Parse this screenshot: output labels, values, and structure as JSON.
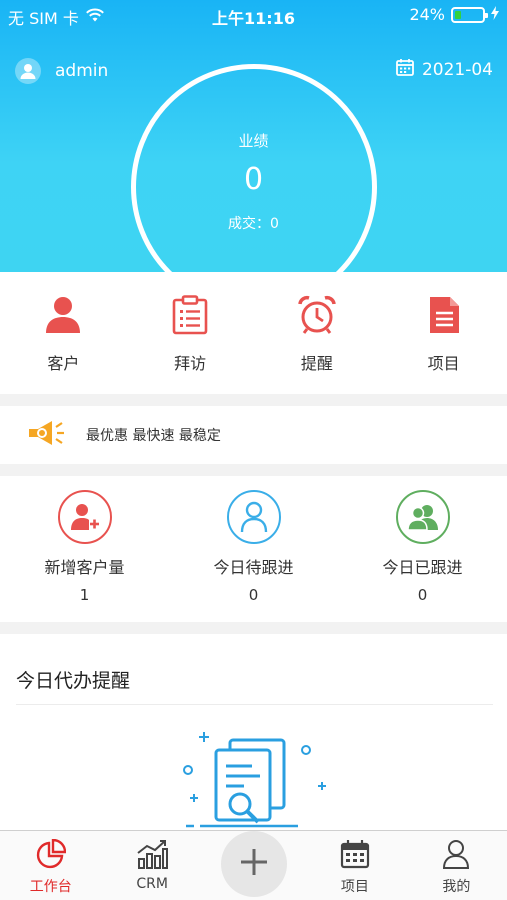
{
  "status_bar": {
    "carrier": "无 SIM 卡",
    "time": "上午11:16",
    "battery": "24%",
    "battery_level": 0.24
  },
  "header": {
    "username": "admin",
    "month": "2021-04",
    "performance_label": "业绩",
    "performance_value": "0",
    "deal_text": "成交：0"
  },
  "quick_menu": [
    {
      "label": "客户",
      "icon": "customer-icon"
    },
    {
      "label": "拜访",
      "icon": "clipboard-icon"
    },
    {
      "label": "提醒",
      "icon": "alarm-clock-icon"
    },
    {
      "label": "项目",
      "icon": "document-icon"
    }
  ],
  "slogan": {
    "text": "最优惠 最快速 最稳定",
    "icon": "megaphone-icon"
  },
  "stats": [
    {
      "label": "新增客户量",
      "value": "1",
      "icon": "add-user-icon",
      "color": "#e8524f"
    },
    {
      "label": "今日待跟进",
      "value": "0",
      "icon": "person-outline-icon",
      "color": "#3aaee8"
    },
    {
      "label": "今日已跟进",
      "value": "0",
      "icon": "group-icon",
      "color": "#5fae5f"
    }
  ],
  "todo": {
    "title": "今日代办提醒"
  },
  "tab_bar": [
    {
      "label": "工作台",
      "icon": "pie-chart-icon",
      "active": true
    },
    {
      "label": "CRM",
      "icon": "bar-chart-icon",
      "active": false
    },
    {
      "label": "",
      "icon": "plus-icon",
      "active": false
    },
    {
      "label": "项目",
      "icon": "calendar-icon",
      "active": false
    },
    {
      "label": "我的",
      "icon": "profile-icon",
      "active": false
    }
  ],
  "colors": {
    "accent_red": "#e8524f",
    "hero_top": "#19b4f5",
    "hero_bottom": "#3ed4f2",
    "active_tab": "#e02a2a"
  }
}
